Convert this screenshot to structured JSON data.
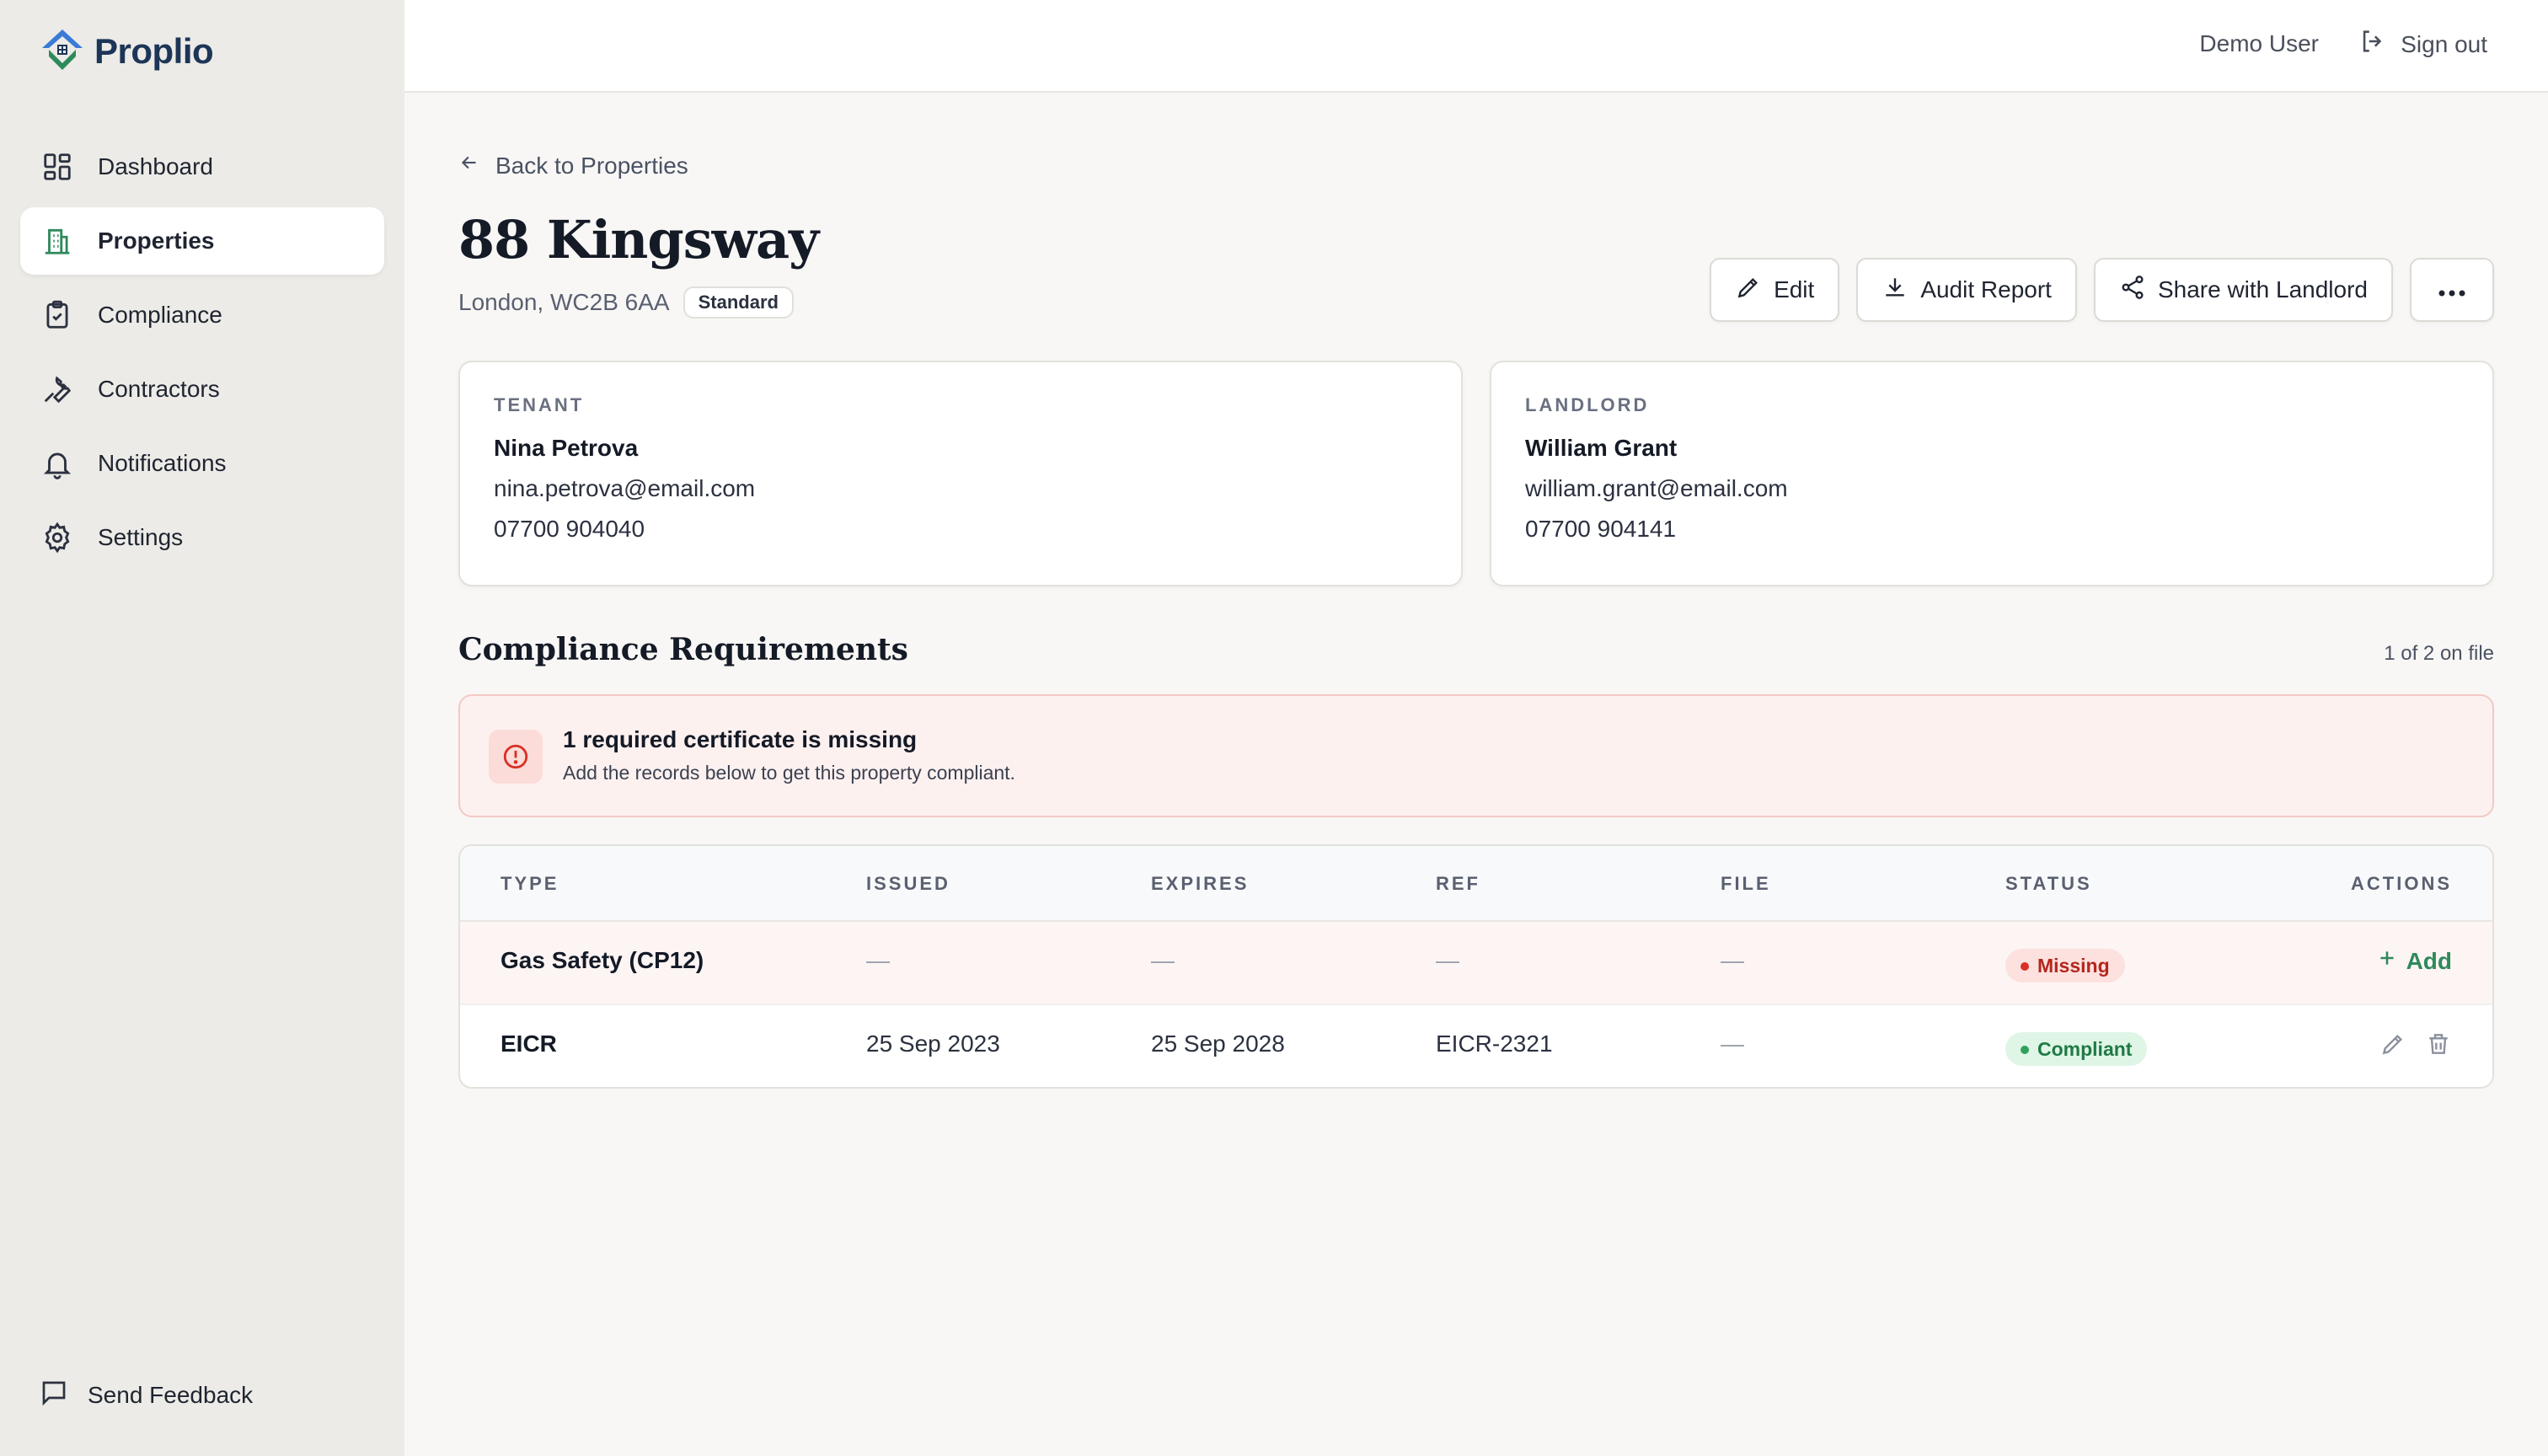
{
  "app": {
    "name": "Proplio"
  },
  "sidebar": {
    "items": [
      {
        "label": "Dashboard",
        "icon": "dashboard-icon",
        "active": false
      },
      {
        "label": "Properties",
        "icon": "building-icon",
        "active": true
      },
      {
        "label": "Compliance",
        "icon": "clipboard-check-icon",
        "active": false
      },
      {
        "label": "Contractors",
        "icon": "wrench-icon",
        "active": false
      },
      {
        "label": "Notifications",
        "icon": "bell-icon",
        "active": false
      },
      {
        "label": "Settings",
        "icon": "gear-icon",
        "active": false
      }
    ],
    "feedback_label": "Send Feedback"
  },
  "topbar": {
    "user": "Demo User",
    "signout": "Sign out"
  },
  "page": {
    "back_label": "Back to Properties",
    "title": "88 Kingsway",
    "address": "London, WC2B 6AA",
    "tag": "Standard",
    "actions": {
      "edit": "Edit",
      "audit": "Audit Report",
      "share": "Share with Landlord"
    }
  },
  "tenant": {
    "label": "TENANT",
    "name": "Nina Petrova",
    "email": "nina.petrova@email.com",
    "phone": "07700 904040"
  },
  "landlord": {
    "label": "LANDLORD",
    "name": "William Grant",
    "email": "william.grant@email.com",
    "phone": "07700 904141"
  },
  "compliance": {
    "title": "Compliance Requirements",
    "on_file": "1 of 2 on file",
    "alert": {
      "heading": "1 required certificate is missing",
      "body": "Add the records below to get this property compliant."
    },
    "columns": [
      "TYPE",
      "ISSUED",
      "EXPIRES",
      "REF",
      "FILE",
      "STATUS",
      "ACTIONS"
    ],
    "rows": [
      {
        "type": "Gas Safety (CP12)",
        "issued": "—",
        "expires": "—",
        "ref": "—",
        "file": "—",
        "status": "Missing",
        "action": "Add"
      },
      {
        "type": "EICR",
        "issued": "25 Sep 2023",
        "expires": "25 Sep 2028",
        "ref": "EICR-2321",
        "file": "—",
        "status": "Compliant",
        "action": ""
      }
    ]
  },
  "colors": {
    "accent": "#2f8a5b",
    "brand": "#1d3557",
    "danger": "#d93025"
  }
}
